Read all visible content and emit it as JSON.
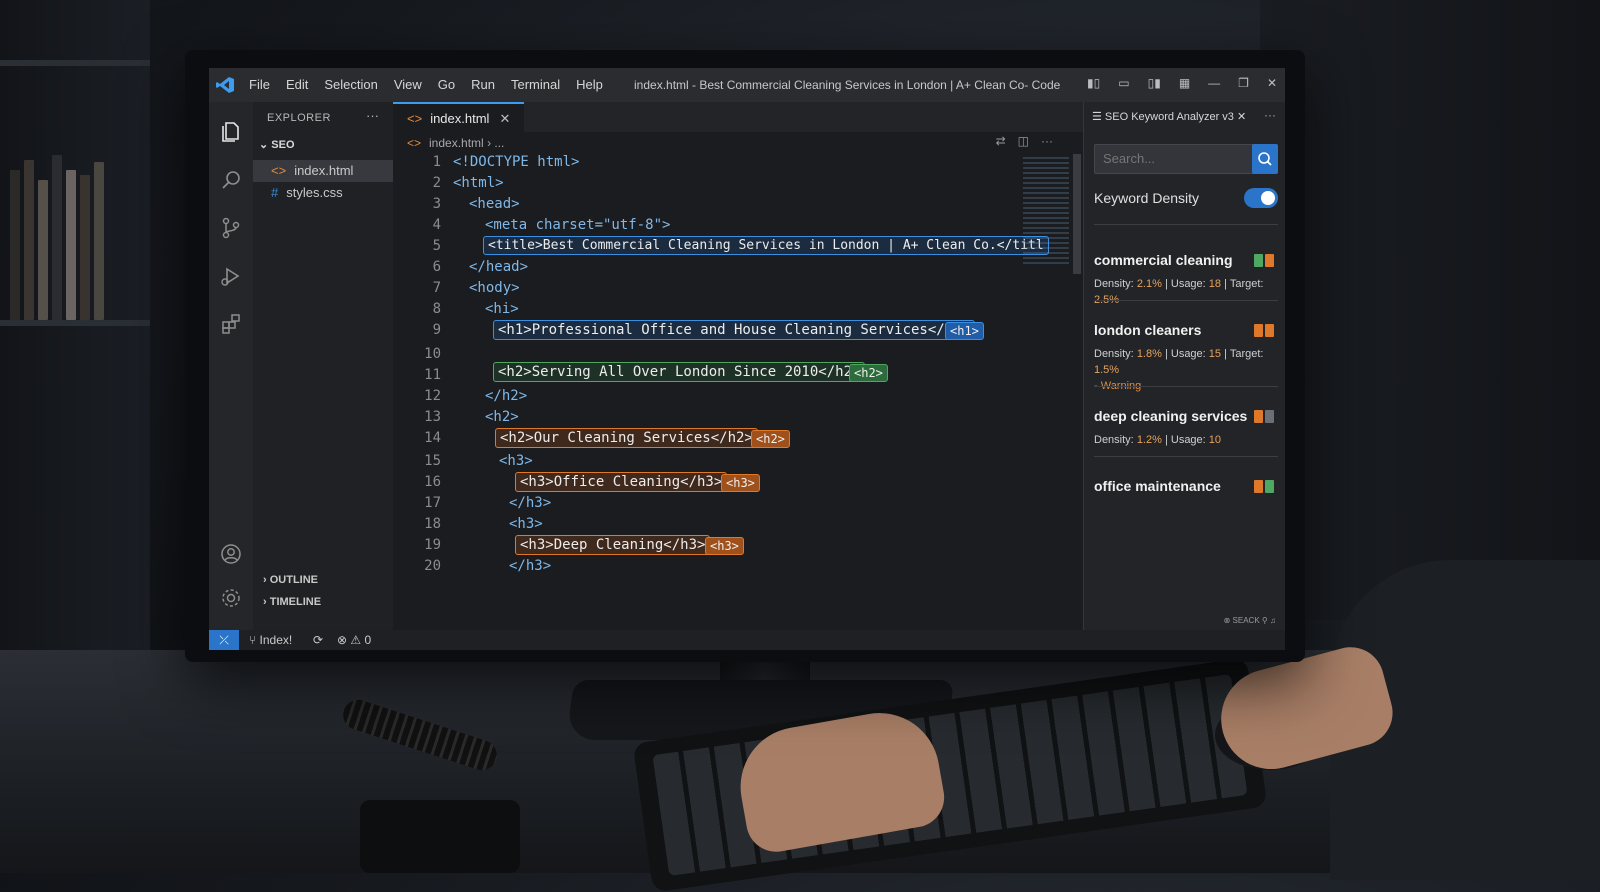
{
  "window": {
    "title": "index.html - Best Commercial Cleaning Services in London | A+ Clean Co- Code",
    "menu": [
      "File",
      "Edit",
      "Selection",
      "View",
      "Go",
      "Run",
      "Terminal",
      "Help"
    ]
  },
  "explorer": {
    "header": "EXPLORER",
    "more": "···",
    "folder": "SEO",
    "files": [
      {
        "name": "index.html",
        "icon": "html-file-icon",
        "active": true
      },
      {
        "name": "styles.css",
        "icon": "css-file-icon",
        "active": false
      }
    ],
    "outline_label": "OUTLINE",
    "timeline_label": "TIMELINE"
  },
  "editor": {
    "tab_label": "index.html",
    "breadcrumb_file": "index.html",
    "breadcrumb_rest": "› ...",
    "line_numbers": [
      "1",
      "2",
      "3",
      "4",
      "5",
      "6",
      "7",
      "8",
      "9",
      "10",
      "11",
      "12",
      "13",
      "14",
      "15",
      "16",
      "17",
      "18",
      "19",
      "20"
    ],
    "plain_lines": {
      "l1": "<!DOCTYPE html>",
      "l2": "<html>",
      "l3": "<head>",
      "l4": "<meta charset=\"utf-8\">",
      "l6": "</head>",
      "l7": "<hody>",
      "l8": "<hi>",
      "l12": "</h2>",
      "l13": "<h2>",
      "l15": "<h3>",
      "l17": "</h3>",
      "l18": "<h3>",
      "l20": "</h3>"
    },
    "highlighted": {
      "title": "<title>Best Commercial Cleaning Services in London | A+ Clean Co.</titl",
      "h1": "<h1>Professional Office and House Cleaning Services</h1>",
      "h1_chip": "<h1>",
      "h2a": "<h2>Serving All Over London Since 2010</h2>",
      "h2a_chip": "<h2>",
      "h2b": "<h2>Our Cleaning Services</h2>",
      "h2b_chip": "<h2>",
      "h3a": "<h3>Office Cleaning</h3>",
      "h3a_chip": "<h3>",
      "h3b": "<h3>Deep Cleaning</h3>",
      "h3b_chip": "<h3>"
    }
  },
  "seo_panel": {
    "title": "SEO Keyword Analyzer v3",
    "search_placeholder": "Search...",
    "keyword_density_label": "Keyword Density",
    "keyword_density_on": true,
    "keywords": [
      {
        "name": "commercial cleaning",
        "density": "2.1%",
        "usage": "18",
        "target": "2.5%",
        "warning": "",
        "colors": [
          "#4fa862",
          "#e0782a"
        ]
      },
      {
        "name": "london cleaners",
        "density": "1.8%",
        "usage": "15",
        "target": "1.5%",
        "warning": "- Warning",
        "colors": [
          "#e0782a",
          "#e0782a"
        ]
      },
      {
        "name": "deep cleaning services",
        "density": "1.2%",
        "usage": "10",
        "target": "",
        "warning": "",
        "colors": [
          "#e0782a",
          "#6b6f77"
        ]
      },
      {
        "name": "office maintenance",
        "density": "",
        "usage": "",
        "target": "",
        "warning": "",
        "colors": [
          "#e0782a",
          "#4fa862"
        ]
      }
    ],
    "labels": {
      "density": "Density:",
      "usage": "Usage:",
      "target": "Target:"
    },
    "footer": "⊗ SEACK"
  },
  "statusbar": {
    "branch": "Index!",
    "problems": "⊗ ⚠ 0"
  }
}
